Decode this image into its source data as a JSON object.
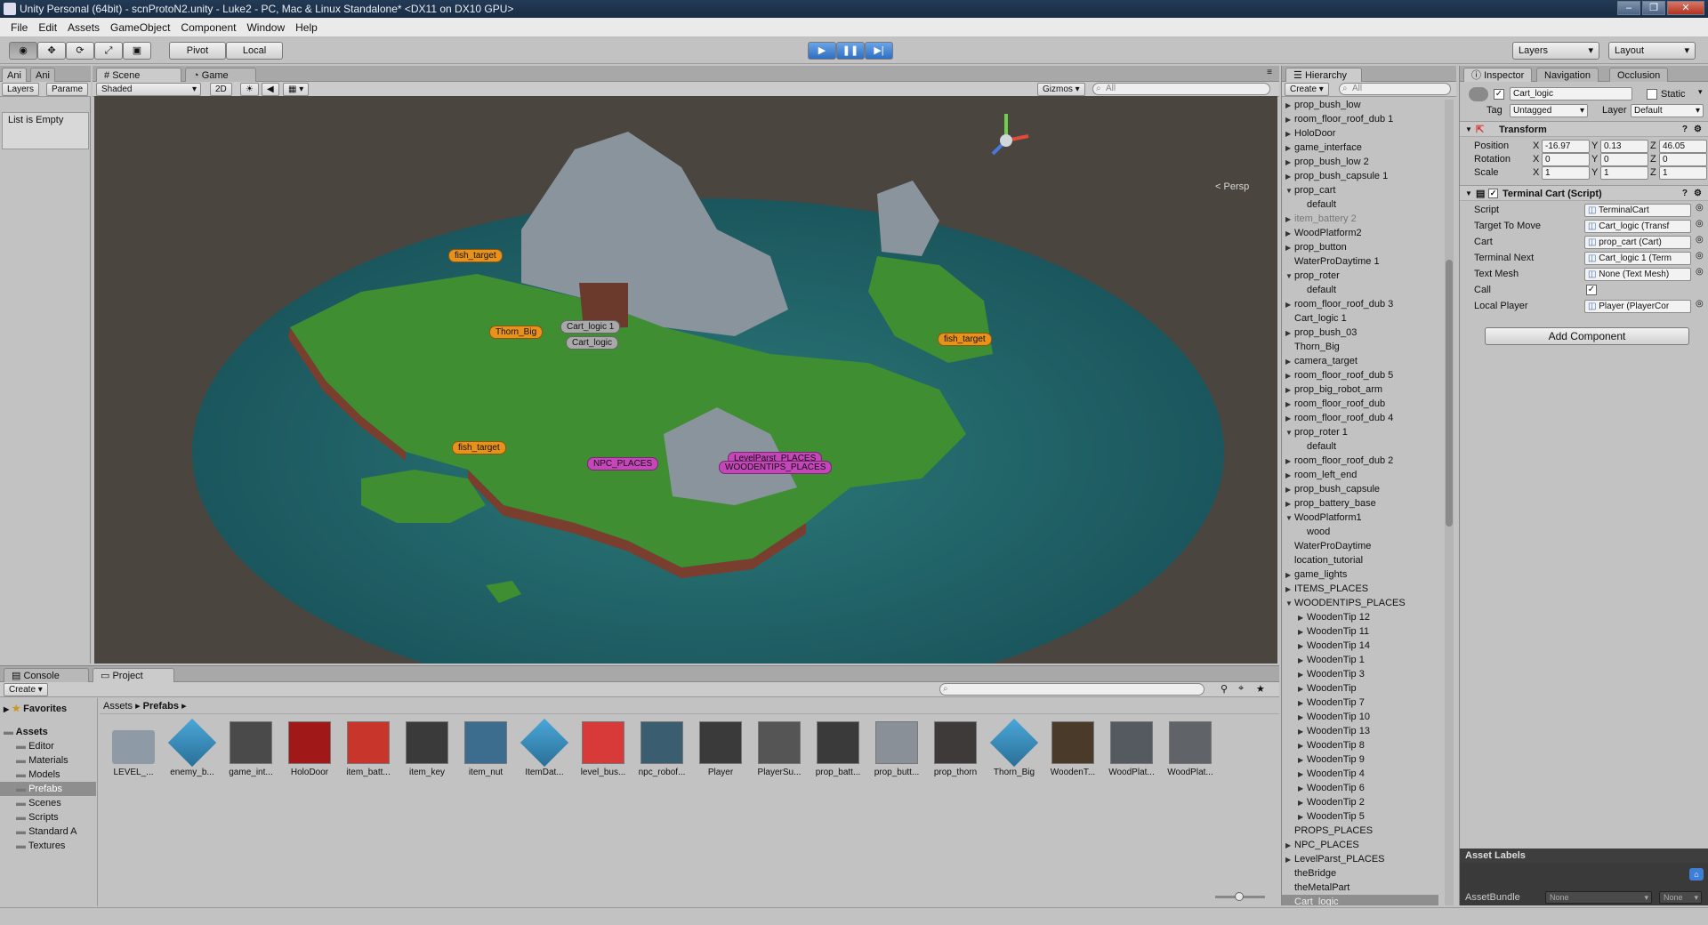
{
  "window": {
    "title": "Unity Personal (64bit) - scnProtoN2.unity - Luke2 - PC, Mac & Linux Standalone* <DX11 on DX10 GPU>"
  },
  "menu": [
    "File",
    "Edit",
    "Assets",
    "GameObject",
    "Component",
    "Window",
    "Help"
  ],
  "toolbar": {
    "pivot": "Pivot",
    "local": "Local",
    "layers": "Layers",
    "layout": "Layout"
  },
  "left_panel": {
    "tabs": [
      "Ani",
      "Ani"
    ],
    "subtabs": [
      "Layers",
      "Parame"
    ],
    "empty_text": "List is Empty"
  },
  "scene": {
    "tabs": [
      "Scene",
      "Game"
    ],
    "shading": "Shaded",
    "mode_2d": "2D",
    "gizmos": "Gizmos",
    "search_placeholder": "All",
    "persp": "Persp",
    "labels": {
      "fish1": "fish_target",
      "fish2": "fish_target",
      "fish3": "fish_target",
      "thorn": "Thorn_Big",
      "cart1": "Cart_logic 1",
      "cart0": "Cart_logic",
      "npc": "NPC_PLACES",
      "level": "LevelParst_PLACES",
      "wooden": "WOODENTIPS_PLACES"
    }
  },
  "hierarchy": {
    "title": "Hierarchy",
    "create": "Create",
    "search_placeholder": "All",
    "items": [
      {
        "label": "prop_bush_low",
        "indent": 0,
        "arrow": "right"
      },
      {
        "label": "room_floor_roof_dub 1",
        "indent": 0,
        "arrow": "right"
      },
      {
        "label": "HoloDoor",
        "indent": 0,
        "arrow": "right"
      },
      {
        "label": "game_interface",
        "indent": 0,
        "arrow": "right"
      },
      {
        "label": "prop_bush_low 2",
        "indent": 0,
        "arrow": "right"
      },
      {
        "label": "prop_bush_capsule 1",
        "indent": 0,
        "arrow": "right"
      },
      {
        "label": "prop_cart",
        "indent": 0,
        "arrow": "down"
      },
      {
        "label": "default",
        "indent": 1,
        "arrow": ""
      },
      {
        "label": "item_battery 2",
        "indent": 0,
        "arrow": "right",
        "dim": true
      },
      {
        "label": "WoodPlatform2",
        "indent": 0,
        "arrow": "right"
      },
      {
        "label": "prop_button",
        "indent": 0,
        "arrow": "right"
      },
      {
        "label": "WaterProDaytime 1",
        "indent": 0,
        "arrow": ""
      },
      {
        "label": "prop_roter",
        "indent": 0,
        "arrow": "down"
      },
      {
        "label": "default",
        "indent": 1,
        "arrow": ""
      },
      {
        "label": "room_floor_roof_dub 3",
        "indent": 0,
        "arrow": "right"
      },
      {
        "label": "Cart_logic 1",
        "indent": 0,
        "arrow": ""
      },
      {
        "label": "prop_bush_03",
        "indent": 0,
        "arrow": "right"
      },
      {
        "label": "Thorn_Big",
        "indent": 0,
        "arrow": ""
      },
      {
        "label": "camera_target",
        "indent": 0,
        "arrow": "right"
      },
      {
        "label": "room_floor_roof_dub 5",
        "indent": 0,
        "arrow": "right"
      },
      {
        "label": "prop_big_robot_arm",
        "indent": 0,
        "arrow": "right"
      },
      {
        "label": "room_floor_roof_dub",
        "indent": 0,
        "arrow": "right"
      },
      {
        "label": "room_floor_roof_dub 4",
        "indent": 0,
        "arrow": "right"
      },
      {
        "label": "prop_roter 1",
        "indent": 0,
        "arrow": "down"
      },
      {
        "label": "default",
        "indent": 1,
        "arrow": ""
      },
      {
        "label": "room_floor_roof_dub 2",
        "indent": 0,
        "arrow": "right"
      },
      {
        "label": "room_left_end",
        "indent": 0,
        "arrow": "right"
      },
      {
        "label": "prop_bush_capsule",
        "indent": 0,
        "arrow": "right"
      },
      {
        "label": "prop_battery_base",
        "indent": 0,
        "arrow": "right"
      },
      {
        "label": "WoodPlatform1",
        "indent": 0,
        "arrow": "down"
      },
      {
        "label": "wood",
        "indent": 1,
        "arrow": ""
      },
      {
        "label": "WaterProDaytime",
        "indent": 0,
        "arrow": ""
      },
      {
        "label": "location_tutorial",
        "indent": 0,
        "arrow": ""
      },
      {
        "label": "game_lights",
        "indent": 0,
        "arrow": "right"
      },
      {
        "label": "ITEMS_PLACES",
        "indent": 0,
        "arrow": "right"
      },
      {
        "label": "WOODENTIPS_PLACES",
        "indent": 0,
        "arrow": "down"
      },
      {
        "label": "WoodenTip 12",
        "indent": 1,
        "arrow": "right"
      },
      {
        "label": "WoodenTip 11",
        "indent": 1,
        "arrow": "right"
      },
      {
        "label": "WoodenTip 14",
        "indent": 1,
        "arrow": "right"
      },
      {
        "label": "WoodenTip 1",
        "indent": 1,
        "arrow": "right"
      },
      {
        "label": "WoodenTip 3",
        "indent": 1,
        "arrow": "right"
      },
      {
        "label": "WoodenTip",
        "indent": 1,
        "arrow": "right"
      },
      {
        "label": "WoodenTip 7",
        "indent": 1,
        "arrow": "right"
      },
      {
        "label": "WoodenTip 10",
        "indent": 1,
        "arrow": "right"
      },
      {
        "label": "WoodenTip 13",
        "indent": 1,
        "arrow": "right"
      },
      {
        "label": "WoodenTip 8",
        "indent": 1,
        "arrow": "right"
      },
      {
        "label": "WoodenTip 9",
        "indent": 1,
        "arrow": "right"
      },
      {
        "label": "WoodenTip 4",
        "indent": 1,
        "arrow": "right"
      },
      {
        "label": "WoodenTip 6",
        "indent": 1,
        "arrow": "right"
      },
      {
        "label": "WoodenTip 2",
        "indent": 1,
        "arrow": "right"
      },
      {
        "label": "WoodenTip 5",
        "indent": 1,
        "arrow": "right"
      },
      {
        "label": "PROPS_PLACES",
        "indent": 0,
        "arrow": ""
      },
      {
        "label": "NPC_PLACES",
        "indent": 0,
        "arrow": "right"
      },
      {
        "label": "LevelParst_PLACES",
        "indent": 0,
        "arrow": "right"
      },
      {
        "label": "theBridge",
        "indent": 0,
        "arrow": ""
      },
      {
        "label": "theMetalPart",
        "indent": 0,
        "arrow": ""
      },
      {
        "label": "Cart_logic",
        "indent": 0,
        "arrow": "",
        "selected": true
      }
    ]
  },
  "inspector": {
    "tabs": [
      "Inspector",
      "Navigation",
      "Occlusion"
    ],
    "object_name": "Cart_logic",
    "static_label": "Static",
    "tag_label": "Tag",
    "tag_value": "Untagged",
    "layer_label": "Layer",
    "layer_value": "Default",
    "transform": {
      "title": "Transform",
      "position_label": "Position",
      "rotation_label": "Rotation",
      "scale_label": "Scale",
      "position": [
        "-16.97",
        "0.13",
        "46.05"
      ],
      "rotation": [
        "0",
        "0",
        "0"
      ],
      "scale": [
        "1",
        "1",
        "1"
      ]
    },
    "script_comp": {
      "title": "Terminal Cart (Script)",
      "fields": [
        {
          "label": "Script",
          "value": "TerminalCart"
        },
        {
          "label": "Target To Move",
          "value": "Cart_logic (Transf"
        },
        {
          "label": "Cart",
          "value": "prop_cart (Cart)"
        },
        {
          "label": "Terminal Next",
          "value": "Cart_logic 1 (Term"
        },
        {
          "label": "Text Mesh",
          "value": "None (Text Mesh)"
        },
        {
          "label": "Call",
          "value": ""
        },
        {
          "label": "Local Player",
          "value": "Player (PlayerCor"
        }
      ]
    },
    "add_component": "Add Component",
    "asset_labels": "Asset Labels",
    "asset_bundle": "AssetBundle",
    "bundle_none1": "None",
    "bundle_none2": "None"
  },
  "bottom": {
    "tabs": [
      "Console",
      "Project"
    ],
    "create": "Create",
    "favorites": "Favorites",
    "breadcrumb": [
      "Assets",
      "Prefabs"
    ],
    "tree": [
      {
        "label": "Assets",
        "indent": 0,
        "bold": true
      },
      {
        "label": "Editor",
        "indent": 1
      },
      {
        "label": "Materials",
        "indent": 1
      },
      {
        "label": "Models",
        "indent": 1
      },
      {
        "label": "Prefabs",
        "indent": 1,
        "selected": true
      },
      {
        "label": "Scenes",
        "indent": 1
      },
      {
        "label": "Scripts",
        "indent": 1
      },
      {
        "label": "Standard A",
        "indent": 1
      },
      {
        "label": "Textures",
        "indent": 1
      }
    ],
    "assets": [
      {
        "label": "LEVEL_...",
        "color": "#8e9aa6",
        "kind": "folder"
      },
      {
        "label": "enemy_b...",
        "color": "#4aa7d8",
        "kind": "cube"
      },
      {
        "label": "game_int...",
        "color": "#4a4a4a",
        "kind": "dark"
      },
      {
        "label": "HoloDoor",
        "color": "#a01818",
        "kind": "box"
      },
      {
        "label": "item_batt...",
        "color": "#c8352a",
        "kind": "box"
      },
      {
        "label": "item_key",
        "color": "#3a3a3a",
        "kind": "dark"
      },
      {
        "label": "item_nut",
        "color": "#3c6d8e",
        "kind": "box"
      },
      {
        "label": "ItemDat...",
        "color": "#4aa7d8",
        "kind": "cube"
      },
      {
        "label": "level_bus...",
        "color": "#d83a3a",
        "kind": "box"
      },
      {
        "label": "npc_robof...",
        "color": "#3a5d70",
        "kind": "dark"
      },
      {
        "label": "Player",
        "color": "#3a3a3a",
        "kind": "dark"
      },
      {
        "label": "PlayerSu...",
        "color": "#555555",
        "kind": "dark"
      },
      {
        "label": "prop_batt...",
        "color": "#3a3a3a",
        "kind": "dark"
      },
      {
        "label": "prop_butt...",
        "color": "#8a9098",
        "kind": "box"
      },
      {
        "label": "prop_thorn",
        "color": "#3f3a3a",
        "kind": "dark"
      },
      {
        "label": "Thorn_Big",
        "color": "#4aa7d8",
        "kind": "cube"
      },
      {
        "label": "WoodenT...",
        "color": "#4a3a2a",
        "kind": "dark"
      },
      {
        "label": "WoodPlat...",
        "color": "#555a60",
        "kind": "dark"
      },
      {
        "label": "WoodPlat...",
        "color": "#606468",
        "kind": "dark"
      }
    ]
  }
}
